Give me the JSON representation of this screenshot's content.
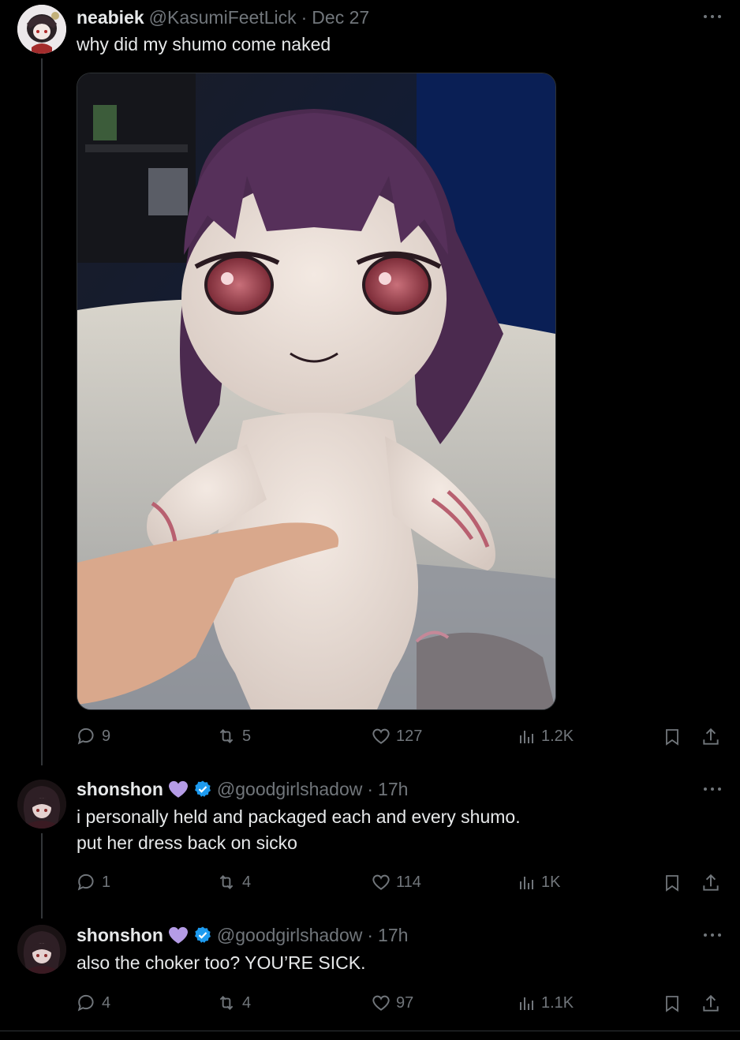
{
  "posts": [
    {
      "display_name": "neabiek",
      "handle": "@KasumiFeetLick",
      "separator": "·",
      "time": "Dec 27",
      "text": "why did my shumo come naked",
      "stats": {
        "replies": "9",
        "reposts": "5",
        "likes": "127",
        "views": "1.2K"
      }
    },
    {
      "display_name": "shonshon",
      "handle": "@goodgirlshadow",
      "separator": "·",
      "time": "17h",
      "text_line1": "i personally held and packaged each and every shumo.",
      "text_line2": "put her dress back on sicko",
      "stats": {
        "replies": "1",
        "reposts": "4",
        "likes": "114",
        "views": "1K"
      }
    },
    {
      "display_name": "shonshon",
      "handle": "@goodgirlshadow",
      "separator": "·",
      "time": "17h",
      "text": "also the choker too? YOU’RE SICK.",
      "stats": {
        "replies": "4",
        "reposts": "4",
        "likes": "97",
        "views": "1.1K"
      }
    }
  ],
  "colors": {
    "background": "#000000",
    "text": "#e7e9ea",
    "muted": "#71767b",
    "verified": "#1d9bf0",
    "heart_badge": "#b59ce6"
  }
}
